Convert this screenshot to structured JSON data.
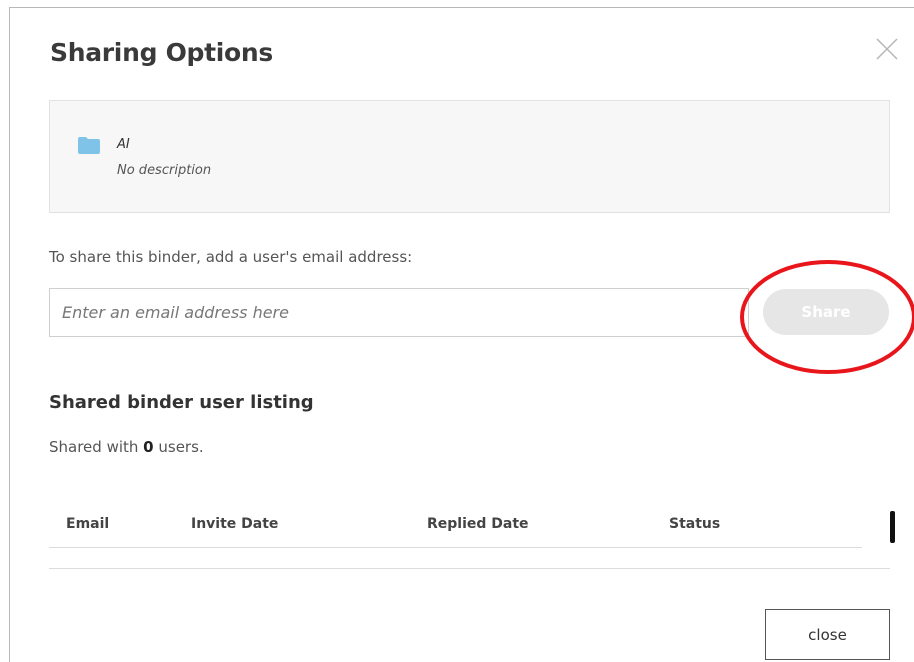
{
  "dialog": {
    "title": "Sharing Options",
    "close_icon": "close-icon"
  },
  "binder": {
    "icon": "folder-icon",
    "icon_color": "#7fc4e8",
    "name": "AI",
    "description": "No description"
  },
  "share": {
    "prompt": "To share this binder, add a user's email address:",
    "placeholder": "Enter an email address here",
    "value": "",
    "button_label": "Share"
  },
  "listing": {
    "title": "Shared binder user listing",
    "count_prefix": "Shared with ",
    "count": "0",
    "count_suffix": " users.",
    "columns": [
      "Email",
      "Invite Date",
      "Replied Date",
      "Status"
    ],
    "rows": []
  },
  "footer": {
    "close_label": "close"
  },
  "annotation": {
    "highlight_color": "#e8151b"
  }
}
